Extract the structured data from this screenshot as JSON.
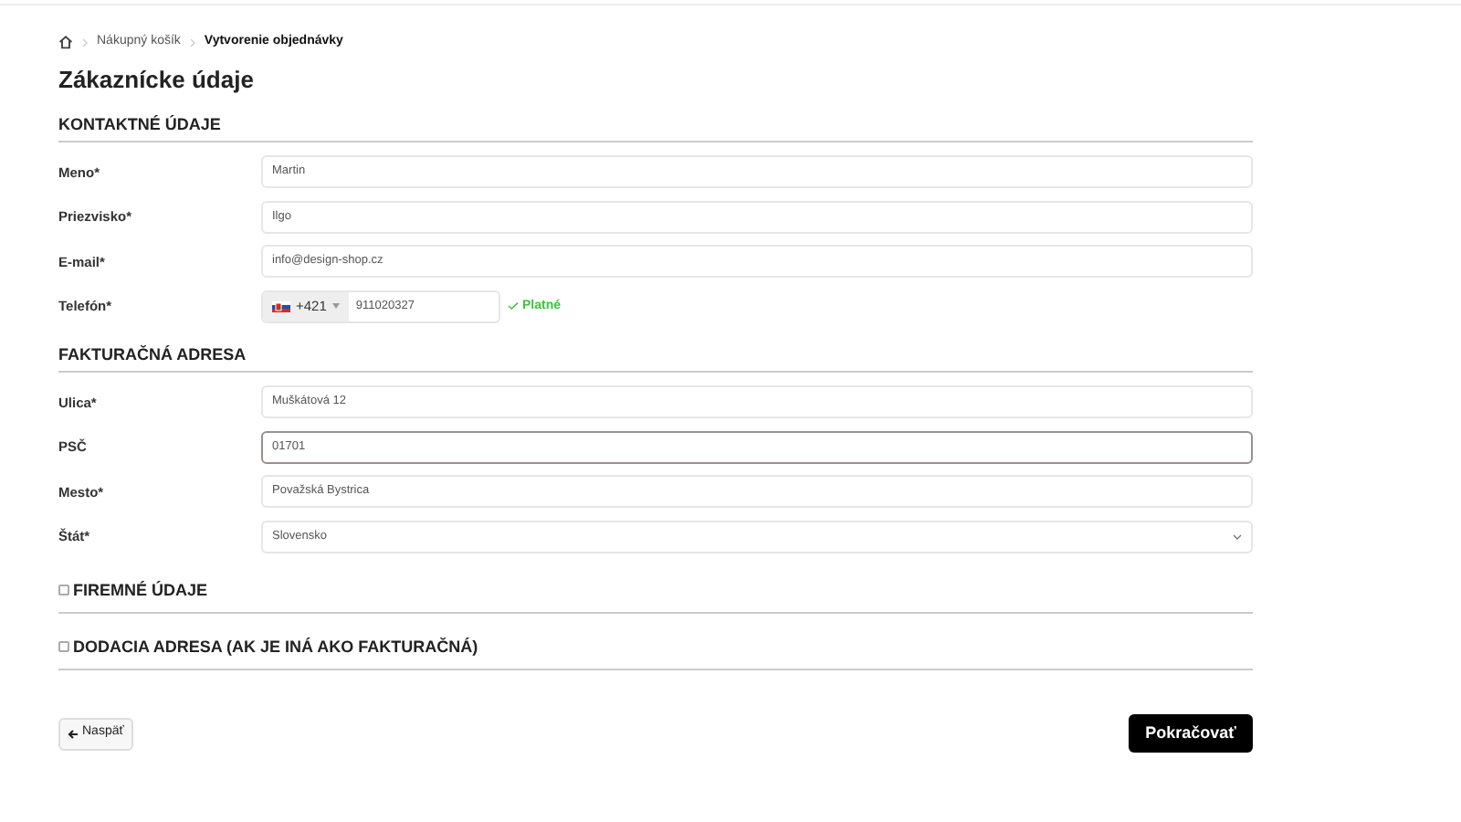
{
  "breadcrumb": [
    {
      "label": "Nákupný košík",
      "current": false
    },
    {
      "label": "Vytvorenie objednávky",
      "current": true
    }
  ],
  "title": "Zákaznícke údaje",
  "sections": [
    {
      "heading": "KONTAKTNÉ ÚDAJE",
      "fields": [
        {
          "kind": "text",
          "label": "Meno*",
          "value": "Martin",
          "focused": false
        },
        {
          "kind": "text",
          "label": "Priezvisko*",
          "value": "Ilgo",
          "focused": false
        },
        {
          "kind": "text",
          "label": "E-mail*",
          "value": "info@design-shop.cz",
          "focused": false
        },
        {
          "kind": "phone",
          "label": "Telefón*",
          "prefix": "+421",
          "value": "911020327",
          "validation": "Platné",
          "focused": false
        }
      ]
    },
    {
      "heading": "FAKTURAČNÁ ADRESA",
      "fields": [
        {
          "kind": "text",
          "label": "Ulica*",
          "value": "Muškátová 12",
          "focused": false
        },
        {
          "kind": "text",
          "label": "PSČ",
          "value": "01701",
          "focused": true
        },
        {
          "kind": "text",
          "label": "Mesto*",
          "value": "Považská Bystrica",
          "focused": false
        },
        {
          "kind": "select",
          "label": "Štát*",
          "value": "Slovensko",
          "focused": false
        }
      ]
    }
  ],
  "optional_sections": [
    {
      "label": "FIREMNÉ ÚDAJE",
      "checked": false
    },
    {
      "label": "DODACIA ADRESA (AK JE INÁ AKO FAKTURAČNÁ)",
      "checked": false
    }
  ],
  "back_button": "Naspäť",
  "continue_button": "Pokračovať"
}
